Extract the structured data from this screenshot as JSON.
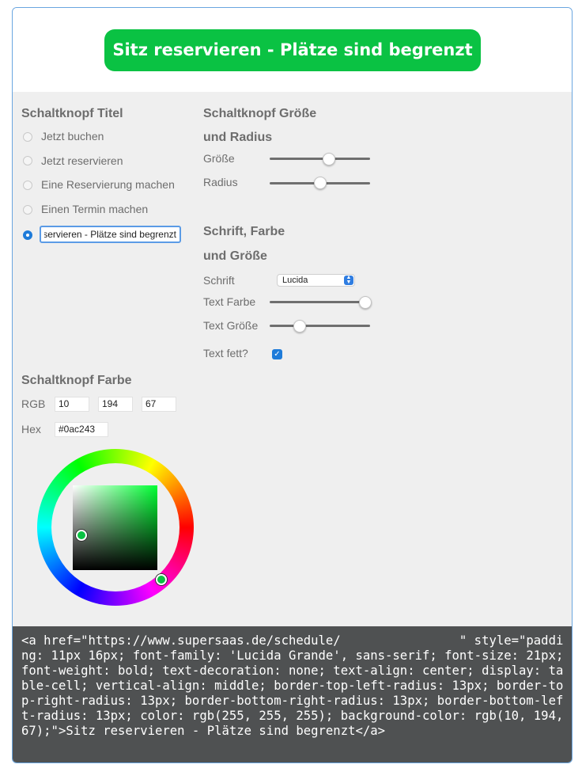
{
  "preview": {
    "button_label": "Sitz reservieren - Plätze sind begrenzt"
  },
  "title_section": {
    "heading": "Schaltknopf Titel",
    "options": [
      "Jetzt buchen",
      "Jetzt reservieren",
      "Eine Reservierung machen",
      "Einen Termin machen"
    ],
    "custom_value": "Sitz reservieren - Plätze sind begrenzt",
    "selected": "custom"
  },
  "size_section": {
    "heading_line1": "Schaltknopf Größe",
    "heading_line2": "und Radius",
    "size_label": "Größe",
    "size_level": 0.59,
    "radius_label": "Radius",
    "radius_level": 0.5
  },
  "font_section": {
    "heading_line1": "Schrift, Farbe",
    "heading_line2": "und Größe",
    "font_label": "Schrift",
    "font_value": "Lucida",
    "text_color_label": "Text Farbe",
    "text_color_level": 0.95,
    "text_size_label": "Text Größe",
    "text_size_level": 0.3,
    "bold_label": "Text fett?",
    "bold_checked": true
  },
  "color_section": {
    "heading": "Schaltknopf Farbe",
    "rgb_label": "RGB",
    "r": "10",
    "g": "194",
    "b": "67",
    "hex_label": "Hex",
    "hex": "#0ac243"
  },
  "code": {
    "text": "<a href=\"https://www.supersaas.de/schedule/                \" style=\"padding: 11px 16px; font-family: 'Lucida Grande', sans-serif; font-size: 21px; font-weight: bold; text-decoration: none; text-align: center; display: table-cell; vertical-align: middle; border-top-left-radius: 13px; border-top-right-radius: 13px; border-bottom-right-radius: 13px; border-bottom-left-radius: 13px; color: rgb(255, 255, 255); background-color: rgb(10, 194, 67);\">Sitz reservieren - Plätze sind begrenzt</a>"
  },
  "colors": {
    "button_green": "#0ac243",
    "code_bg": "#4f5152",
    "accent_blue": "#1e7bd9"
  }
}
